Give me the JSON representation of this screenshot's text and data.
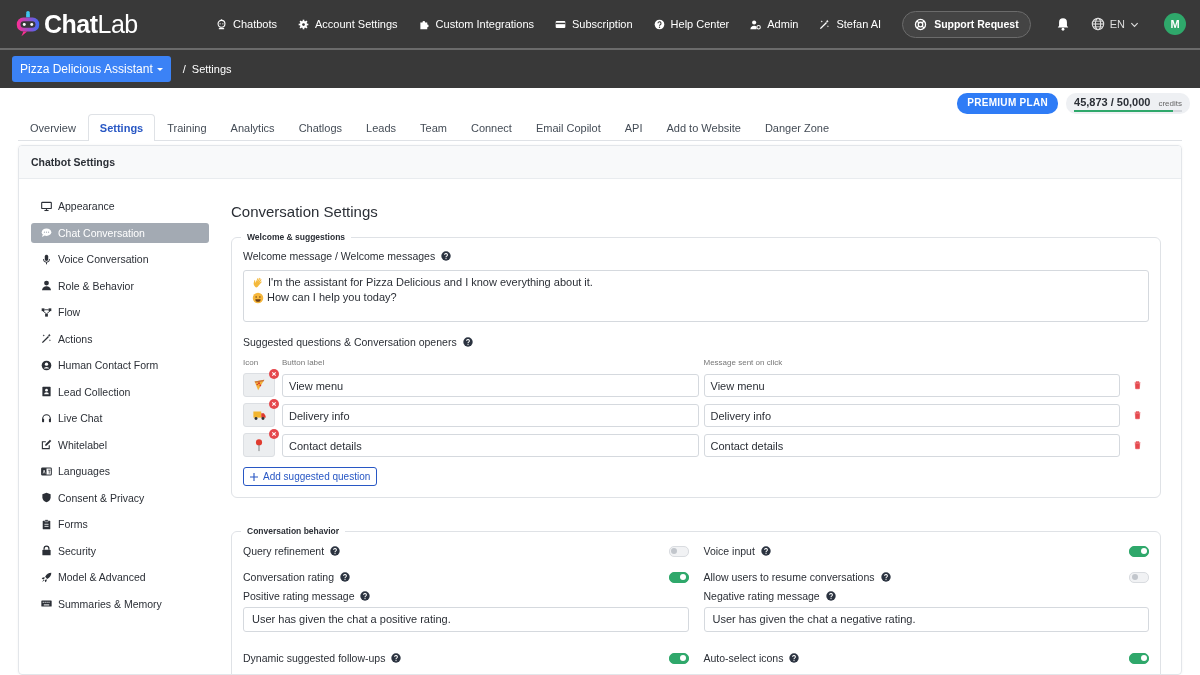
{
  "header": {
    "logo": {
      "first": "Chat",
      "second": "Lab"
    },
    "nav": [
      "Chatbots",
      "Account Settings",
      "Custom Integrations",
      "Subscription",
      "Help Center",
      "Admin",
      "Stefan AI"
    ],
    "support_button": "Support Request",
    "language": "EN",
    "avatar": "M"
  },
  "subbar": {
    "bot_selector": "Pizza Delicious Assistant",
    "separator": "/",
    "crumb": "Settings"
  },
  "plan": {
    "badge": "PREMIUM PLAN",
    "credits_used": "45,873",
    "credits_total": "/ 50,000",
    "credits_label": "credits",
    "level": 0.917
  },
  "tabs": [
    {
      "label": "Overview",
      "selected": false
    },
    {
      "label": "Settings",
      "selected": true
    },
    {
      "label": "Training",
      "selected": false
    },
    {
      "label": "Analytics",
      "selected": false
    },
    {
      "label": "Chatlogs",
      "selected": false
    },
    {
      "label": "Leads",
      "selected": false
    },
    {
      "label": "Team",
      "selected": false
    },
    {
      "label": "Connect",
      "selected": false
    },
    {
      "label": "Email Copilot",
      "selected": false
    },
    {
      "label": "API",
      "selected": false
    },
    {
      "label": "Add to Website",
      "selected": false
    },
    {
      "label": "Danger Zone",
      "selected": false
    }
  ],
  "card": {
    "title": "Chatbot Settings",
    "sidebar": {
      "items": [
        {
          "label": "Appearance",
          "selected": false
        },
        {
          "label": "Chat Conversation",
          "selected": true
        },
        {
          "label": "Voice Conversation",
          "selected": false
        },
        {
          "label": "Role & Behavior",
          "selected": false
        },
        {
          "label": "Flow",
          "selected": false
        },
        {
          "label": "Actions",
          "selected": false
        },
        {
          "label": "Human Contact Form",
          "selected": false
        },
        {
          "label": "Lead Collection",
          "selected": false
        },
        {
          "label": "Live Chat",
          "selected": false
        },
        {
          "label": "Whitelabel",
          "selected": false
        },
        {
          "label": "Languages",
          "selected": false
        },
        {
          "label": "Consent & Privacy",
          "selected": false
        },
        {
          "label": "Forms",
          "selected": false
        },
        {
          "label": "Security",
          "selected": false
        },
        {
          "label": "Model & Advanced",
          "selected": false
        },
        {
          "label": "Summaries & Memory",
          "selected": false
        }
      ]
    },
    "content": {
      "title": "Conversation Settings",
      "welcome": {
        "legend": "Welcome & suggestions",
        "message_label": "Welcome message / Welcome messages",
        "message_lines": [
          "I'm the assistant for Pizza Delicious and I know everything about it.",
          "How can I help you today?"
        ],
        "suggested_label": "Suggested questions & Conversation openers",
        "columns": [
          "Icon",
          "Button label",
          "Message sent on click"
        ],
        "suggestions": [
          {
            "label": "View menu",
            "message": "View menu"
          },
          {
            "label": "Delivery info",
            "message": "Delivery info"
          },
          {
            "label": "Contact details",
            "message": "Contact details"
          }
        ],
        "add_button": "Add suggested question"
      },
      "behavior": {
        "legend": "Conversation behavior",
        "items": [
          {
            "kind": "toggle",
            "label": "Query refinement",
            "on": false
          },
          {
            "kind": "toggle",
            "label": "Voice input",
            "on": true
          },
          {
            "kind": "toggle",
            "label": "Conversation rating",
            "on": true
          },
          {
            "kind": "toggle",
            "label": "Allow users to resume conversations",
            "on": false
          },
          {
            "kind": "field",
            "label": "Positive rating message",
            "value": "User has given the chat a positive rating."
          },
          {
            "kind": "field",
            "label": "Negative rating message",
            "value": "User has given the chat a negative rating."
          },
          {
            "kind": "toggle",
            "label": "Dynamic suggested follow-ups",
            "on": true
          },
          {
            "kind": "toggle",
            "label": "Auto-select icons",
            "on": true
          }
        ]
      }
    }
  }
}
